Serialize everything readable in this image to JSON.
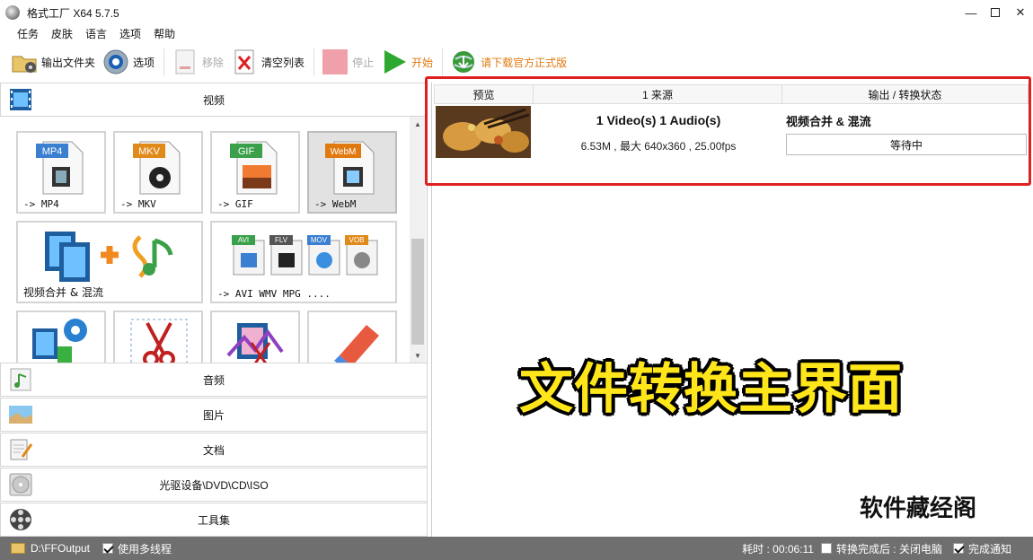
{
  "window": {
    "title": "格式工厂 X64 5.7.5",
    "minimize_icon": "minimize-icon",
    "maximize_icon": "maximize-icon",
    "close_icon": "close-icon"
  },
  "menu": [
    "任务",
    "皮肤",
    "语言",
    "选项",
    "帮助"
  ],
  "toolbar": {
    "output_folder": "输出文件夹",
    "options": "选项",
    "remove": "移除",
    "clear_list": "清空列表",
    "stop": "停止",
    "start": "开始",
    "download_official": "请下载官方正式版"
  },
  "left": {
    "video_category": "视频",
    "tiles": [
      {
        "label": "-> MP4",
        "badge": "MP4",
        "badge_color": "#3a7fd0"
      },
      {
        "label": "-> MKV",
        "badge": "MKV",
        "badge_color": "#e08a1a"
      },
      {
        "label": "-> GIF",
        "badge": "GIF",
        "badge_color": "#3aa04a"
      },
      {
        "label": "-> WebM",
        "badge": "WebM",
        "badge_color": "#e07a10"
      }
    ],
    "merge_tile": "视频合并 & 混流",
    "multi_tile": "-> AVI WMV MPG ....",
    "multi_badges": [
      "AVI",
      "FLV",
      "MOV",
      "VOB"
    ],
    "categories": [
      "音频",
      "图片",
      "文档",
      "光驱设备\\DVD\\CD\\ISO",
      "工具集"
    ]
  },
  "tasks": {
    "headers": [
      "预览",
      "1 来源",
      "输出 / 转换状态"
    ],
    "row": {
      "source_title": "1 Video(s) 1 Audio(s)",
      "source_info": "6.53M , 最大 640x360 , 25.00fps",
      "output_title": "视频合并 & 混流",
      "status": "等待中"
    }
  },
  "overlay": {
    "headline": "文件转换主界面",
    "watermark": "软件藏经阁"
  },
  "statusbar": {
    "output_path": "D:\\FFOutput",
    "multithread": "使用多线程",
    "elapsed": "耗时 : 00:06:11",
    "after_convert": "转换完成后 : 关闭电脑",
    "notify": "完成通知"
  },
  "colors": {
    "accent_red": "#e02020",
    "headline_yellow": "#ffe61a",
    "statusbar_bg": "#6f6f6f",
    "start_green": "#2fa82f",
    "download_orange": "#e07a10"
  }
}
